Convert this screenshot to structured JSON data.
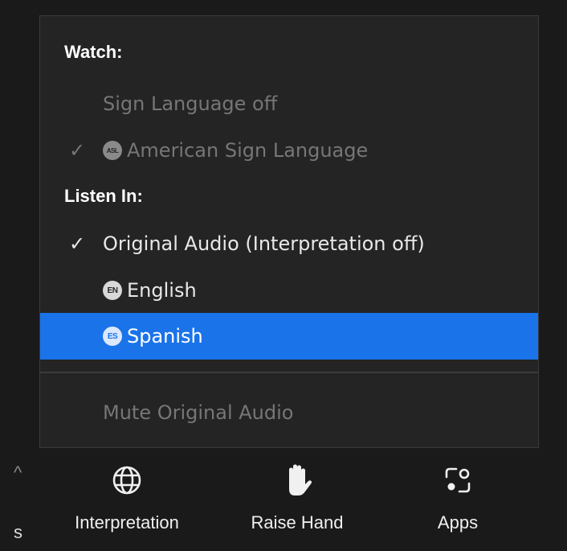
{
  "menu": {
    "watch_header": "Watch:",
    "watch_items": [
      {
        "label": "Sign Language off",
        "checked": false,
        "disabled": true,
        "badge": null
      },
      {
        "label": "American Sign Language",
        "checked": true,
        "disabled": true,
        "badge": "ASL"
      }
    ],
    "listen_header": "Listen In:",
    "listen_items": [
      {
        "label": "Original Audio (Interpretation off)",
        "checked": true,
        "disabled": false,
        "badge": null
      },
      {
        "label": "English",
        "checked": false,
        "disabled": false,
        "badge": "EN"
      },
      {
        "label": "Spanish",
        "checked": false,
        "disabled": false,
        "badge": "ES",
        "highlighted": true
      }
    ],
    "mute_label": "Mute Original Audio",
    "check_glyph": "✓"
  },
  "toolbar": {
    "edge_fragment_top": "^",
    "edge_fragment_bottom": "s",
    "items": [
      {
        "label": "Interpretation",
        "icon": "globe-icon"
      },
      {
        "label": "Raise Hand",
        "icon": "hand-icon"
      },
      {
        "label": "Apps",
        "icon": "apps-icon"
      }
    ]
  },
  "colors": {
    "menu_bg": "#242424",
    "highlight": "#1a73e8",
    "text": "#e8e8e8",
    "disabled_text": "#767676"
  }
}
